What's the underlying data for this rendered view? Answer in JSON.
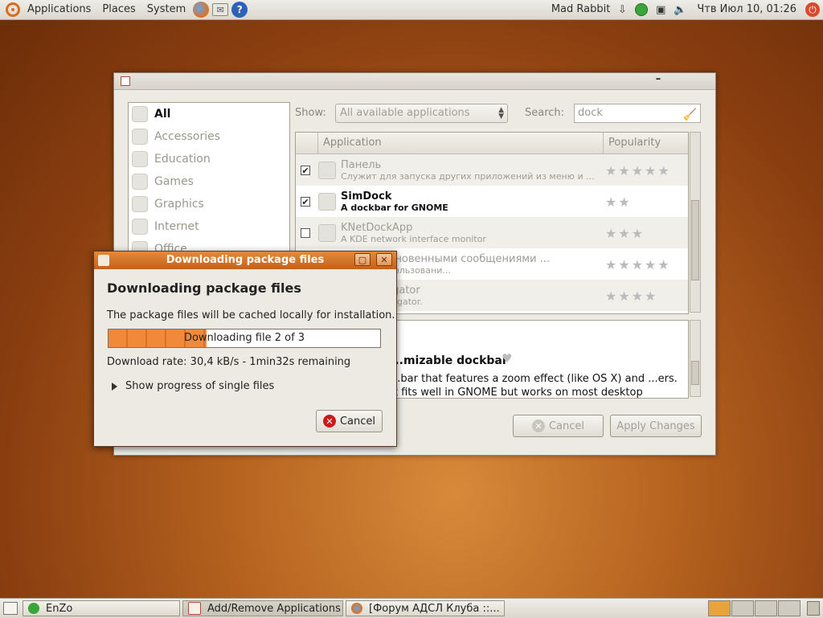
{
  "top_panel": {
    "menus": [
      "Applications",
      "Places",
      "System"
    ],
    "user": "Mad Rabbit",
    "clock": "Чтв Июл 10, 01:26"
  },
  "main_window": {
    "categories": [
      {
        "label": "All"
      },
      {
        "label": "Accessories"
      },
      {
        "label": "Education"
      },
      {
        "label": "Games"
      },
      {
        "label": "Graphics"
      },
      {
        "label": "Internet"
      },
      {
        "label": "Office"
      }
    ],
    "show_label": "Show:",
    "show_value": "All available applications",
    "search_label": "Search:",
    "search_value": "dock",
    "columns": {
      "application": "Application",
      "popularity": "Popularity"
    },
    "rows": [
      {
        "name": "Панель",
        "desc": "Служит для запуска других приложений из меню и ...",
        "checked": true,
        "stars": 5
      },
      {
        "name": "SimDock",
        "desc": "A dockbar for GNOME",
        "checked": true,
        "stars": 2
      },
      {
        "name": "KNetDockApp",
        "desc": "A KDE network interface monitor",
        "checked": false,
        "stars": 3
      },
      {
        "name": "...мена мгновенными сообщениями ...",
        "desc": "...ями с использовани...",
        "checked": false,
        "stars": 5
      },
      {
        "name": "...ow Navigator",
        "desc": "...indow navigator.",
        "checked": false,
        "stars": 4
      }
    ],
    "details": {
      "title": "...mizable dockbar",
      "text": "...bar that features a zoom effect (like OS X) and ...ers. It fits well in GNOME but works on most desktop"
    },
    "cancel_label": "Cancel",
    "apply_label": "Apply Changes"
  },
  "dialog": {
    "title": "Downloading package files",
    "heading": "Downloading package files",
    "text": "The package files will be cached locally for installation.",
    "progress_text": "Downloading file 2 of 3",
    "progress_fraction": 0.36,
    "rate": "Download rate: 30,4 kB/s - 1min32s remaining",
    "expander": "Show progress of single files",
    "cancel_label": "Cancel"
  },
  "taskbar": {
    "items": [
      "EnZo",
      "Add/Remove Applications",
      "[Форум АДСЛ Клуба ::..."
    ]
  }
}
